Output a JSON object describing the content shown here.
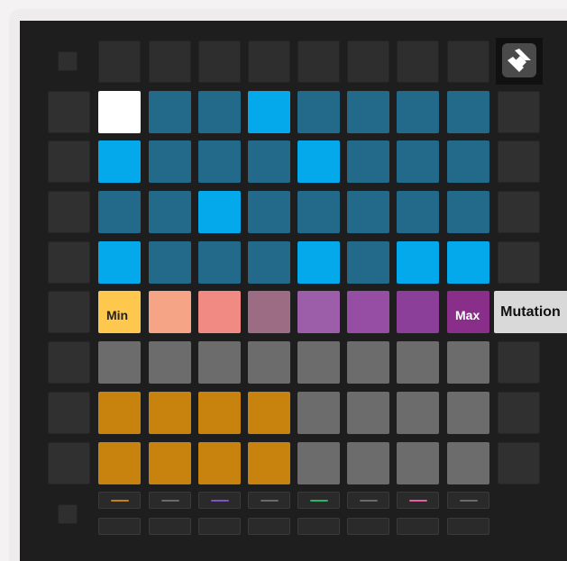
{
  "colors": {
    "white": "#ffffff",
    "dark_blue": "#236a8a",
    "bright_blue": "#04a9ec",
    "gray": "#6c6c6c",
    "orange": "#c8830f",
    "strip_orange": "#c8830f",
    "strip_gray": "#6a6a6a",
    "strip_purple": "#7d55c0",
    "strip_green": "#2db16b",
    "strip_pink": "#e35f9d"
  },
  "grid": [
    [
      "white",
      "dark_blue",
      "dark_blue",
      "bright_blue",
      "dark_blue",
      "dark_blue",
      "dark_blue",
      "dark_blue"
    ],
    [
      "bright_blue",
      "dark_blue",
      "dark_blue",
      "dark_blue",
      "bright_blue",
      "dark_blue",
      "dark_blue",
      "dark_blue"
    ],
    [
      "dark_blue",
      "dark_blue",
      "bright_blue",
      "dark_blue",
      "dark_blue",
      "dark_blue",
      "dark_blue",
      "dark_blue"
    ],
    [
      "bright_blue",
      "dark_blue",
      "dark_blue",
      "dark_blue",
      "bright_blue",
      "dark_blue",
      "bright_blue",
      "bright_blue"
    ],
    [
      "#fdc84d",
      "#f5a585",
      "#f08a82",
      "#9c6b84",
      "#9c5ea8",
      "#954ea3",
      "#8c3f98",
      "#892f8a"
    ],
    [
      "gray",
      "gray",
      "gray",
      "gray",
      "gray",
      "gray",
      "gray",
      "gray"
    ],
    [
      "orange",
      "orange",
      "orange",
      "orange",
      "gray",
      "gray",
      "gray",
      "gray"
    ],
    [
      "orange",
      "orange",
      "orange",
      "orange",
      "gray",
      "gray",
      "gray",
      "gray"
    ]
  ],
  "mutation_row": {
    "min_label": "Min",
    "max_label": "Max",
    "mutation_label": "Mutation"
  },
  "track_strip": [
    "strip_orange",
    "strip_gray",
    "strip_purple",
    "strip_gray",
    "strip_green",
    "strip_gray",
    "strip_pink",
    "strip_gray"
  ],
  "icons": {
    "logo": "novation-logo-icon"
  }
}
